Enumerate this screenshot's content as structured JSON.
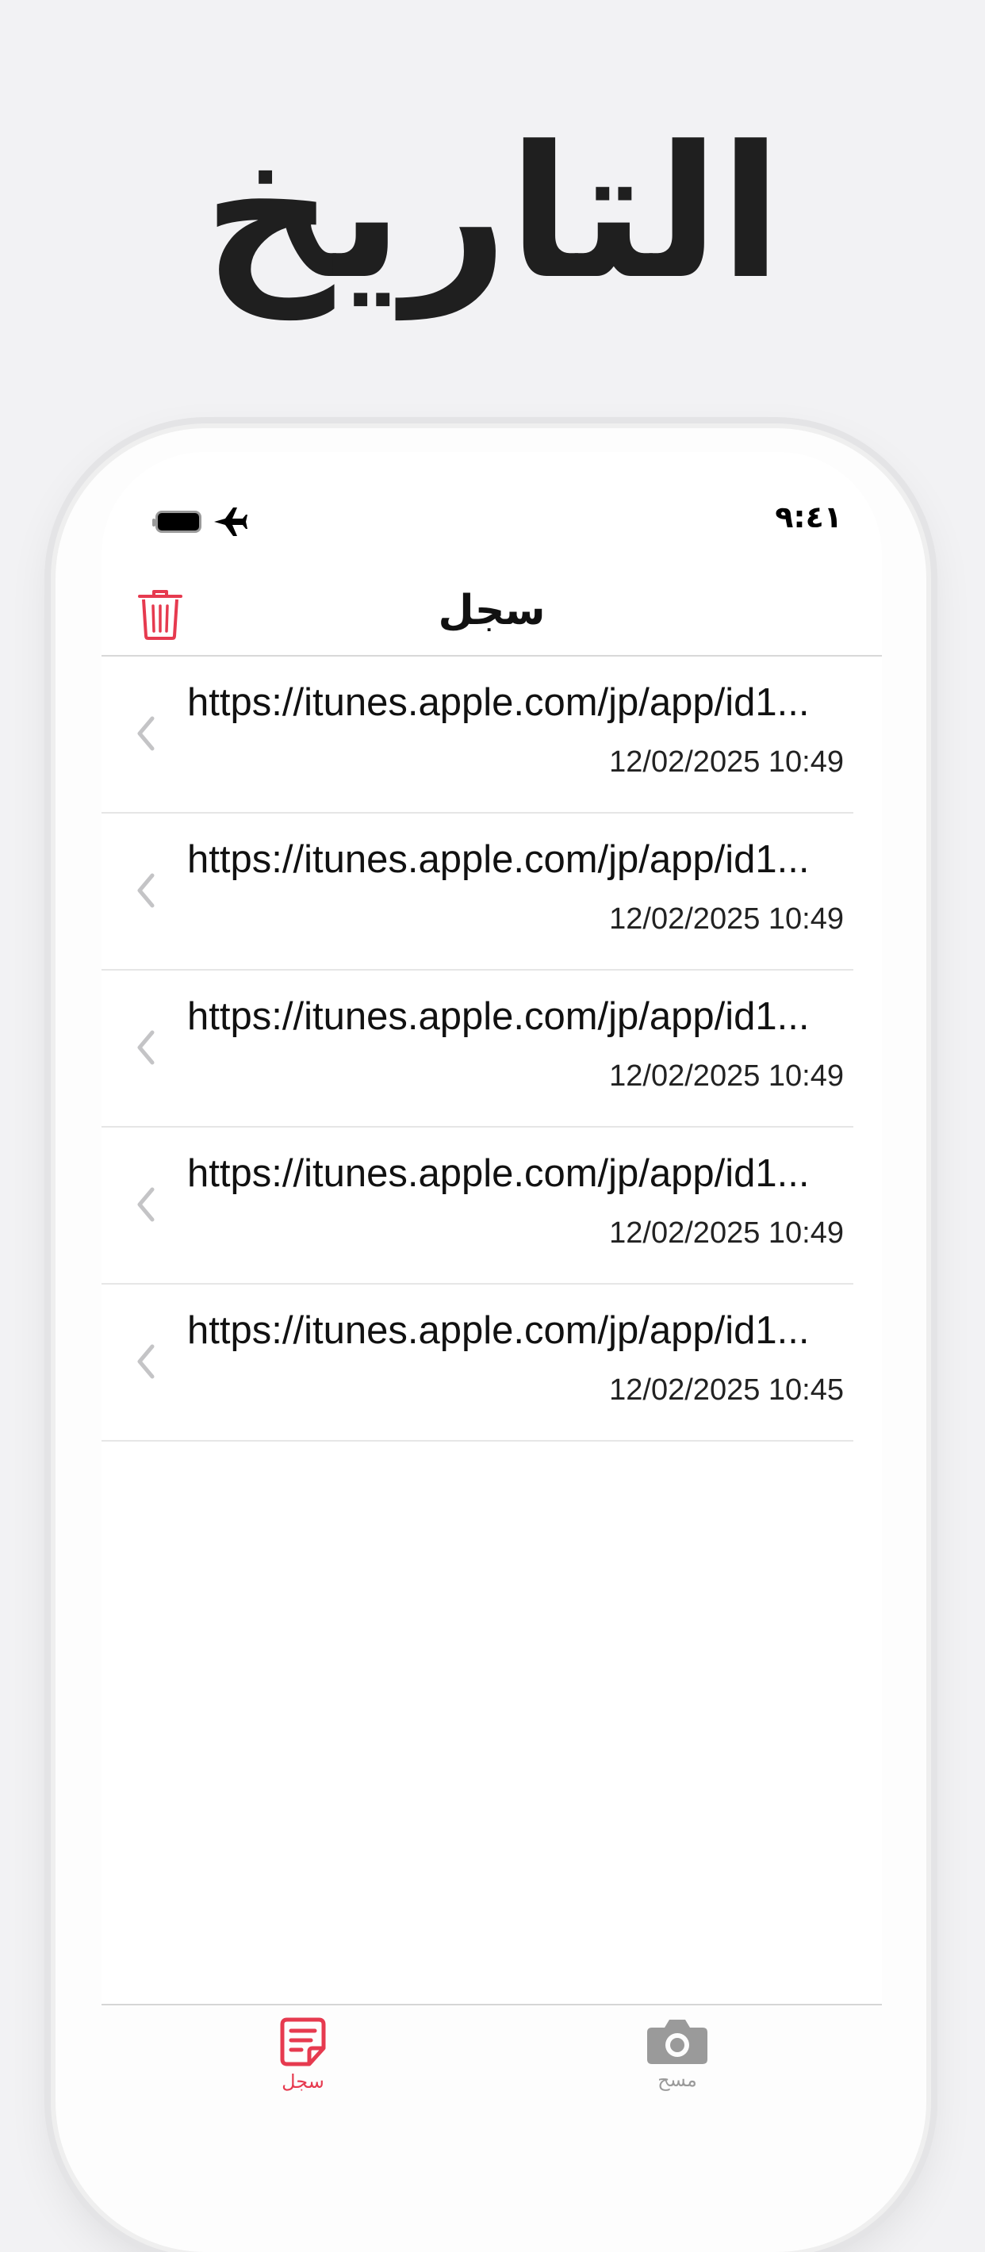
{
  "hero": {
    "title": "التاريخ"
  },
  "status_bar": {
    "time": "٩:٤١"
  },
  "nav": {
    "title": "سجل"
  },
  "history": {
    "items": [
      {
        "url": "https://itunes.apple.com/jp/app/id1...",
        "date": "12/02/2025 10:49"
      },
      {
        "url": "https://itunes.apple.com/jp/app/id1...",
        "date": "12/02/2025 10:49"
      },
      {
        "url": "https://itunes.apple.com/jp/app/id1...",
        "date": "12/02/2025 10:49"
      },
      {
        "url": "https://itunes.apple.com/jp/app/id1...",
        "date": "12/02/2025 10:49"
      },
      {
        "url": "https://itunes.apple.com/jp/app/id1...",
        "date": "12/02/2025 10:45"
      }
    ]
  },
  "tabs": [
    {
      "label": "سجل",
      "icon": "history-note-icon",
      "active": true
    },
    {
      "label": "مسح",
      "icon": "camera-icon",
      "active": false
    }
  ],
  "colors": {
    "accent": "#e63a4f",
    "inactive": "#9a9a9a",
    "background": "#f2f2f4"
  }
}
